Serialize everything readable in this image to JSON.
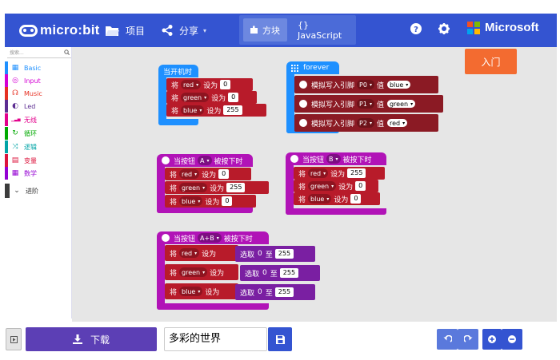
{
  "header": {
    "logo_text": "micro:bit",
    "projects_label": "项目",
    "share_label": "分享",
    "blocks_tab": "方块",
    "js_tab": "{} JavaScript",
    "brand": "Microsoft",
    "start_label": "入门",
    "colors": {
      "bar": "#3454d1",
      "start": "#f36b30"
    }
  },
  "toolbox": {
    "search_placeholder": "搜索...",
    "categories": [
      {
        "label": "Basic",
        "icon": "grid-icon",
        "color": "#1e90ff"
      },
      {
        "label": "Input",
        "icon": "target-icon",
        "color": "#d400d4"
      },
      {
        "label": "Music",
        "icon": "headphones-icon",
        "color": "#e63022"
      },
      {
        "label": "Led",
        "icon": "toggle-icon",
        "color": "#5c2d91"
      },
      {
        "label": "无线",
        "icon": "signal-icon",
        "color": "#e3008c"
      },
      {
        "label": "循环",
        "icon": "loop-icon",
        "color": "#00aa00"
      },
      {
        "label": "逻辑",
        "icon": "shuffle-icon",
        "color": "#00a4a6"
      },
      {
        "label": "变量",
        "icon": "list-icon",
        "color": "#dc143c"
      },
      {
        "label": "数学",
        "icon": "calculator-icon",
        "color": "#9400d3"
      },
      {
        "label": "进阶",
        "icon": "chevron-down-icon",
        "color": "#3c3c3c"
      }
    ]
  },
  "blocks": {
    "on_start": {
      "title": "当开机时",
      "rows": [
        {
          "pre": "将",
          "var": "red",
          "mid": "设为",
          "val": "0"
        },
        {
          "pre": "将",
          "var": "green",
          "mid": "设为",
          "val": "0"
        },
        {
          "pre": "将",
          "var": "blue",
          "mid": "设为",
          "val": "255"
        }
      ]
    },
    "forever": {
      "title": "forever",
      "rows": [
        {
          "pre": "模拟写入引脚",
          "pin": "P0",
          "mid": "值",
          "var": "blue"
        },
        {
          "pre": "模拟写入引脚",
          "pin": "P1",
          "mid": "值",
          "var": "green"
        },
        {
          "pre": "模拟写入引脚",
          "pin": "P2",
          "mid": "值",
          "var": "red"
        }
      ]
    },
    "button_a": {
      "pre": "当按钮",
      "button": "A",
      "post": "被按下时",
      "rows": [
        {
          "pre": "将",
          "var": "red",
          "mid": "设为",
          "val": "0"
        },
        {
          "pre": "将",
          "var": "green",
          "mid": "设为",
          "val": "255"
        },
        {
          "pre": "将",
          "var": "blue",
          "mid": "设为",
          "val": "0"
        }
      ]
    },
    "button_b": {
      "pre": "当按钮",
      "button": "B",
      "post": "被按下时",
      "rows": [
        {
          "pre": "将",
          "var": "red",
          "mid": "设为",
          "val": "255"
        },
        {
          "pre": "将",
          "var": "green",
          "mid": "设为",
          "val": "0"
        },
        {
          "pre": "将",
          "var": "blue",
          "mid": "设为",
          "val": "0"
        }
      ]
    },
    "button_ab": {
      "pre": "当按钮",
      "button": "A+B",
      "post": "被按下时",
      "rows": [
        {
          "pre": "将",
          "var": "red",
          "mid": "设为",
          "pick": "选取",
          "from": "0",
          "to_word": "至",
          "to": "255"
        },
        {
          "pre": "将",
          "var": "green",
          "mid": "设为",
          "pick": "选取",
          "from": "0",
          "to_word": "至",
          "to": "255"
        },
        {
          "pre": "将",
          "var": "blue",
          "mid": "设为",
          "pick": "选取",
          "from": "0",
          "to_word": "至",
          "to": "255"
        }
      ]
    }
  },
  "footer": {
    "download_label": "下载",
    "project_name": "多彩的世界"
  }
}
